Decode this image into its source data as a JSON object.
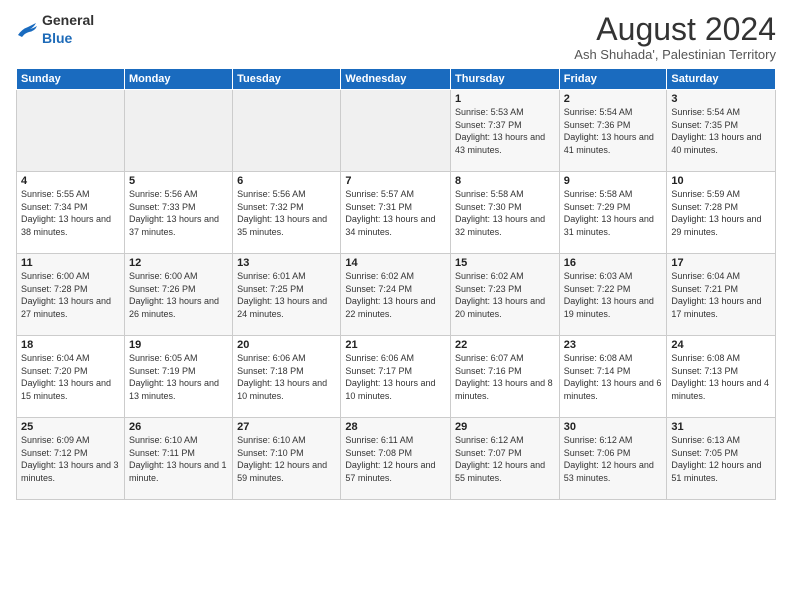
{
  "logo": {
    "general": "General",
    "blue": "Blue"
  },
  "title": "August 2024",
  "subtitle": "Ash Shuhada', Palestinian Territory",
  "days_header": [
    "Sunday",
    "Monday",
    "Tuesday",
    "Wednesday",
    "Thursday",
    "Friday",
    "Saturday"
  ],
  "weeks": [
    [
      {
        "day": "",
        "sunrise": "",
        "sunset": "",
        "daylight": ""
      },
      {
        "day": "",
        "sunrise": "",
        "sunset": "",
        "daylight": ""
      },
      {
        "day": "",
        "sunrise": "",
        "sunset": "",
        "daylight": ""
      },
      {
        "day": "",
        "sunrise": "",
        "sunset": "",
        "daylight": ""
      },
      {
        "day": "1",
        "sunrise": "Sunrise: 5:53 AM",
        "sunset": "Sunset: 7:37 PM",
        "daylight": "Daylight: 13 hours and 43 minutes."
      },
      {
        "day": "2",
        "sunrise": "Sunrise: 5:54 AM",
        "sunset": "Sunset: 7:36 PM",
        "daylight": "Daylight: 13 hours and 41 minutes."
      },
      {
        "day": "3",
        "sunrise": "Sunrise: 5:54 AM",
        "sunset": "Sunset: 7:35 PM",
        "daylight": "Daylight: 13 hours and 40 minutes."
      }
    ],
    [
      {
        "day": "4",
        "sunrise": "Sunrise: 5:55 AM",
        "sunset": "Sunset: 7:34 PM",
        "daylight": "Daylight: 13 hours and 38 minutes."
      },
      {
        "day": "5",
        "sunrise": "Sunrise: 5:56 AM",
        "sunset": "Sunset: 7:33 PM",
        "daylight": "Daylight: 13 hours and 37 minutes."
      },
      {
        "day": "6",
        "sunrise": "Sunrise: 5:56 AM",
        "sunset": "Sunset: 7:32 PM",
        "daylight": "Daylight: 13 hours and 35 minutes."
      },
      {
        "day": "7",
        "sunrise": "Sunrise: 5:57 AM",
        "sunset": "Sunset: 7:31 PM",
        "daylight": "Daylight: 13 hours and 34 minutes."
      },
      {
        "day": "8",
        "sunrise": "Sunrise: 5:58 AM",
        "sunset": "Sunset: 7:30 PM",
        "daylight": "Daylight: 13 hours and 32 minutes."
      },
      {
        "day": "9",
        "sunrise": "Sunrise: 5:58 AM",
        "sunset": "Sunset: 7:29 PM",
        "daylight": "Daylight: 13 hours and 31 minutes."
      },
      {
        "day": "10",
        "sunrise": "Sunrise: 5:59 AM",
        "sunset": "Sunset: 7:28 PM",
        "daylight": "Daylight: 13 hours and 29 minutes."
      }
    ],
    [
      {
        "day": "11",
        "sunrise": "Sunrise: 6:00 AM",
        "sunset": "Sunset: 7:28 PM",
        "daylight": "Daylight: 13 hours and 27 minutes."
      },
      {
        "day": "12",
        "sunrise": "Sunrise: 6:00 AM",
        "sunset": "Sunset: 7:26 PM",
        "daylight": "Daylight: 13 hours and 26 minutes."
      },
      {
        "day": "13",
        "sunrise": "Sunrise: 6:01 AM",
        "sunset": "Sunset: 7:25 PM",
        "daylight": "Daylight: 13 hours and 24 minutes."
      },
      {
        "day": "14",
        "sunrise": "Sunrise: 6:02 AM",
        "sunset": "Sunset: 7:24 PM",
        "daylight": "Daylight: 13 hours and 22 minutes."
      },
      {
        "day": "15",
        "sunrise": "Sunrise: 6:02 AM",
        "sunset": "Sunset: 7:23 PM",
        "daylight": "Daylight: 13 hours and 20 minutes."
      },
      {
        "day": "16",
        "sunrise": "Sunrise: 6:03 AM",
        "sunset": "Sunset: 7:22 PM",
        "daylight": "Daylight: 13 hours and 19 minutes."
      },
      {
        "day": "17",
        "sunrise": "Sunrise: 6:04 AM",
        "sunset": "Sunset: 7:21 PM",
        "daylight": "Daylight: 13 hours and 17 minutes."
      }
    ],
    [
      {
        "day": "18",
        "sunrise": "Sunrise: 6:04 AM",
        "sunset": "Sunset: 7:20 PM",
        "daylight": "Daylight: 13 hours and 15 minutes."
      },
      {
        "day": "19",
        "sunrise": "Sunrise: 6:05 AM",
        "sunset": "Sunset: 7:19 PM",
        "daylight": "Daylight: 13 hours and 13 minutes."
      },
      {
        "day": "20",
        "sunrise": "Sunrise: 6:06 AM",
        "sunset": "Sunset: 7:18 PM",
        "daylight": "Daylight: 13 hours and 10 minutes."
      },
      {
        "day": "21",
        "sunrise": "Sunrise: 6:06 AM",
        "sunset": "Sunset: 7:17 PM",
        "daylight": "Daylight: 13 hours and 10 minutes."
      },
      {
        "day": "22",
        "sunrise": "Sunrise: 6:07 AM",
        "sunset": "Sunset: 7:16 PM",
        "daylight": "Daylight: 13 hours and 8 minutes."
      },
      {
        "day": "23",
        "sunrise": "Sunrise: 6:08 AM",
        "sunset": "Sunset: 7:14 PM",
        "daylight": "Daylight: 13 hours and 6 minutes."
      },
      {
        "day": "24",
        "sunrise": "Sunrise: 6:08 AM",
        "sunset": "Sunset: 7:13 PM",
        "daylight": "Daylight: 13 hours and 4 minutes."
      }
    ],
    [
      {
        "day": "25",
        "sunrise": "Sunrise: 6:09 AM",
        "sunset": "Sunset: 7:12 PM",
        "daylight": "Daylight: 13 hours and 3 minutes."
      },
      {
        "day": "26",
        "sunrise": "Sunrise: 6:10 AM",
        "sunset": "Sunset: 7:11 PM",
        "daylight": "Daylight: 13 hours and 1 minute."
      },
      {
        "day": "27",
        "sunrise": "Sunrise: 6:10 AM",
        "sunset": "Sunset: 7:10 PM",
        "daylight": "Daylight: 12 hours and 59 minutes."
      },
      {
        "day": "28",
        "sunrise": "Sunrise: 6:11 AM",
        "sunset": "Sunset: 7:08 PM",
        "daylight": "Daylight: 12 hours and 57 minutes."
      },
      {
        "day": "29",
        "sunrise": "Sunrise: 6:12 AM",
        "sunset": "Sunset: 7:07 PM",
        "daylight": "Daylight: 12 hours and 55 minutes."
      },
      {
        "day": "30",
        "sunrise": "Sunrise: 6:12 AM",
        "sunset": "Sunset: 7:06 PM",
        "daylight": "Daylight: 12 hours and 53 minutes."
      },
      {
        "day": "31",
        "sunrise": "Sunrise: 6:13 AM",
        "sunset": "Sunset: 7:05 PM",
        "daylight": "Daylight: 12 hours and 51 minutes."
      }
    ]
  ]
}
